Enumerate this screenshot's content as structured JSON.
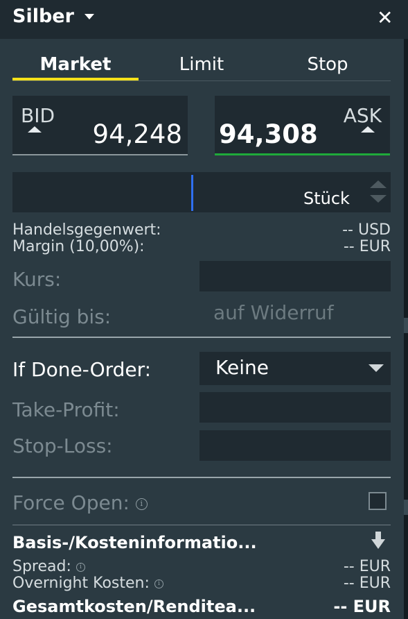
{
  "header": {
    "title": "Silber",
    "close_glyph": "✕"
  },
  "tabs": [
    {
      "label": "Market",
      "active": true
    },
    {
      "label": "Limit",
      "active": false
    },
    {
      "label": "Stop",
      "active": false
    }
  ],
  "prices": {
    "bid_label": "BID",
    "bid_value": "94,248",
    "ask_label": "ASK",
    "ask_value": "94,308"
  },
  "quantity": {
    "value": "",
    "unit": "Stück"
  },
  "summary": {
    "handelsgegenwert_label": "Handelsgegenwert:",
    "handelsgegenwert_value": "-- USD",
    "margin_label": "Margin (10,00%):",
    "margin_value": "-- EUR"
  },
  "order": {
    "kurs_label": "Kurs:",
    "gueltig_label": "Gültig bis:",
    "gueltig_placeholder": "auf Widerruf"
  },
  "if_done": {
    "label": "If Done-Order:",
    "selected": "Keine",
    "take_profit_label": "Take-Profit:",
    "stop_loss_label": "Stop-Loss:"
  },
  "force_open": {
    "label": "Force Open:",
    "checked": false
  },
  "costs": {
    "title": "Basis-/Kosteninformatio...",
    "spread_label": "Spread:",
    "spread_value": "-- EUR",
    "overnight_label": "Overnight Kosten:",
    "overnight_value": "-- EUR",
    "gesamt_label": "Gesamtkosten/Renditea...",
    "gesamt_value": "-- EUR",
    "info_glyph": "i"
  },
  "colors": {
    "accent_tab": "#f5e11a",
    "ask_underline": "#1faa3a",
    "cursor": "#2f6ff0",
    "panel_bg": "#2b3a42",
    "field_bg": "#1f2a31"
  }
}
